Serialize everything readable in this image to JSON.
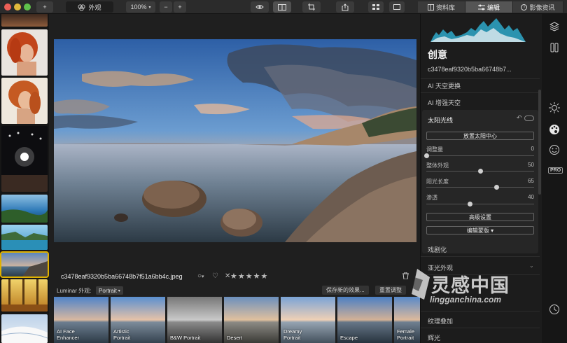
{
  "colors": {
    "accent": "#e0b100",
    "toolbar": "#2b2b2b",
    "panel": "#1c1c1c"
  },
  "toolbar": {
    "add_label": "+",
    "looks_view_label": "外观",
    "zoom_value": "100%",
    "zoom_out_label": "−",
    "zoom_in_label": "+",
    "tabs": [
      {
        "label": "资料库",
        "icon": "library-icon"
      },
      {
        "label": "编辑",
        "icon": "sliders-icon"
      },
      {
        "label": "影像资讯",
        "icon": "info-icon"
      }
    ]
  },
  "filmstrip": {
    "thumbnails": [
      "portrait-red-hair",
      "portrait-red-hair-2",
      "stage-lights",
      "lake-landscape",
      "coastal-cliffs",
      "lake-selected",
      "autumn-forest",
      "snow-dunes"
    ]
  },
  "image": {
    "filename": "c3478eaf9320b5ba66748b7f51a6bb4c.jpeg",
    "rating_stars": "★★★★★",
    "reject_label": "✕",
    "favorite_label": "♡"
  },
  "looks": {
    "label": "Luminar 外观:",
    "category": "Portrait",
    "save_label": "保存新的效果...",
    "reset_label": "重置调整",
    "items": [
      "AI Face Enhancer",
      "Artistic Portrait",
      "B&W Portrait",
      "Desert",
      "Dreamy Portrait",
      "Escape",
      "Female Portrait"
    ]
  },
  "panel": {
    "title": "创意",
    "subtitle": "c3478eaf9320b5ba66748b7...",
    "items_top": [
      "AI 天空更换",
      "AI 增强天空"
    ],
    "tool": {
      "title": "太阳光线",
      "place_sun_label": "放置太阳中心",
      "sliders": [
        {
          "label": "调整量",
          "value": 0
        },
        {
          "label": "整体外观",
          "value": 50
        },
        {
          "label": "阳光长度",
          "value": 65
        },
        {
          "label": "渗透",
          "value": 40
        }
      ],
      "advanced_label": "高级设置",
      "mask_label": "编辑蒙版 ▾"
    },
    "items_bottom": [
      "戏剧化",
      "亚光外观",
      "纹理叠加",
      "辉光"
    ]
  },
  "watermark": {
    "text": "灵感中国",
    "url": "lingganchina.com"
  }
}
